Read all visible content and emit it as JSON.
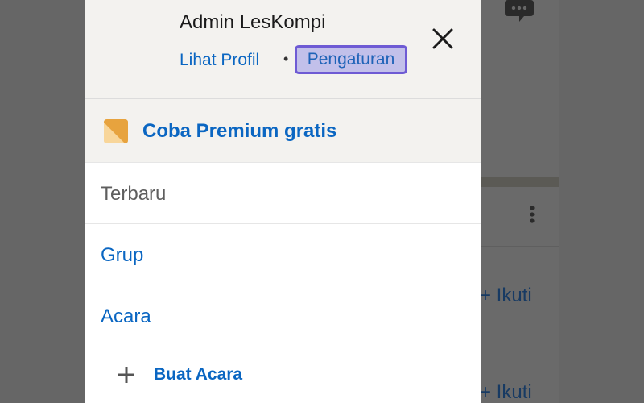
{
  "background": {
    "follow_labels": [
      "+ Ikuti",
      "+ Ikuti"
    ]
  },
  "drawer": {
    "user_name": "Admin LesKompi",
    "view_profile_label": "Lihat Profil",
    "separator": "•",
    "settings_label": "Pengaturan",
    "premium_label": "Coba Premium gratis",
    "menu": {
      "recent": "Terbaru",
      "groups": "Grup",
      "events": "Acara"
    },
    "create_event_label": "Buat Acara"
  },
  "colors": {
    "link_blue": "#0a66c2",
    "highlight_border": "#6e5bd4",
    "highlight_fill": "#c2c0ea",
    "premium_gold": "#e7a33e"
  },
  "icons": {
    "close": "close-icon",
    "premium": "premium-icon",
    "plus": "plus-icon",
    "chat": "chat-bubble-icon",
    "more": "more-vertical-icon"
  }
}
